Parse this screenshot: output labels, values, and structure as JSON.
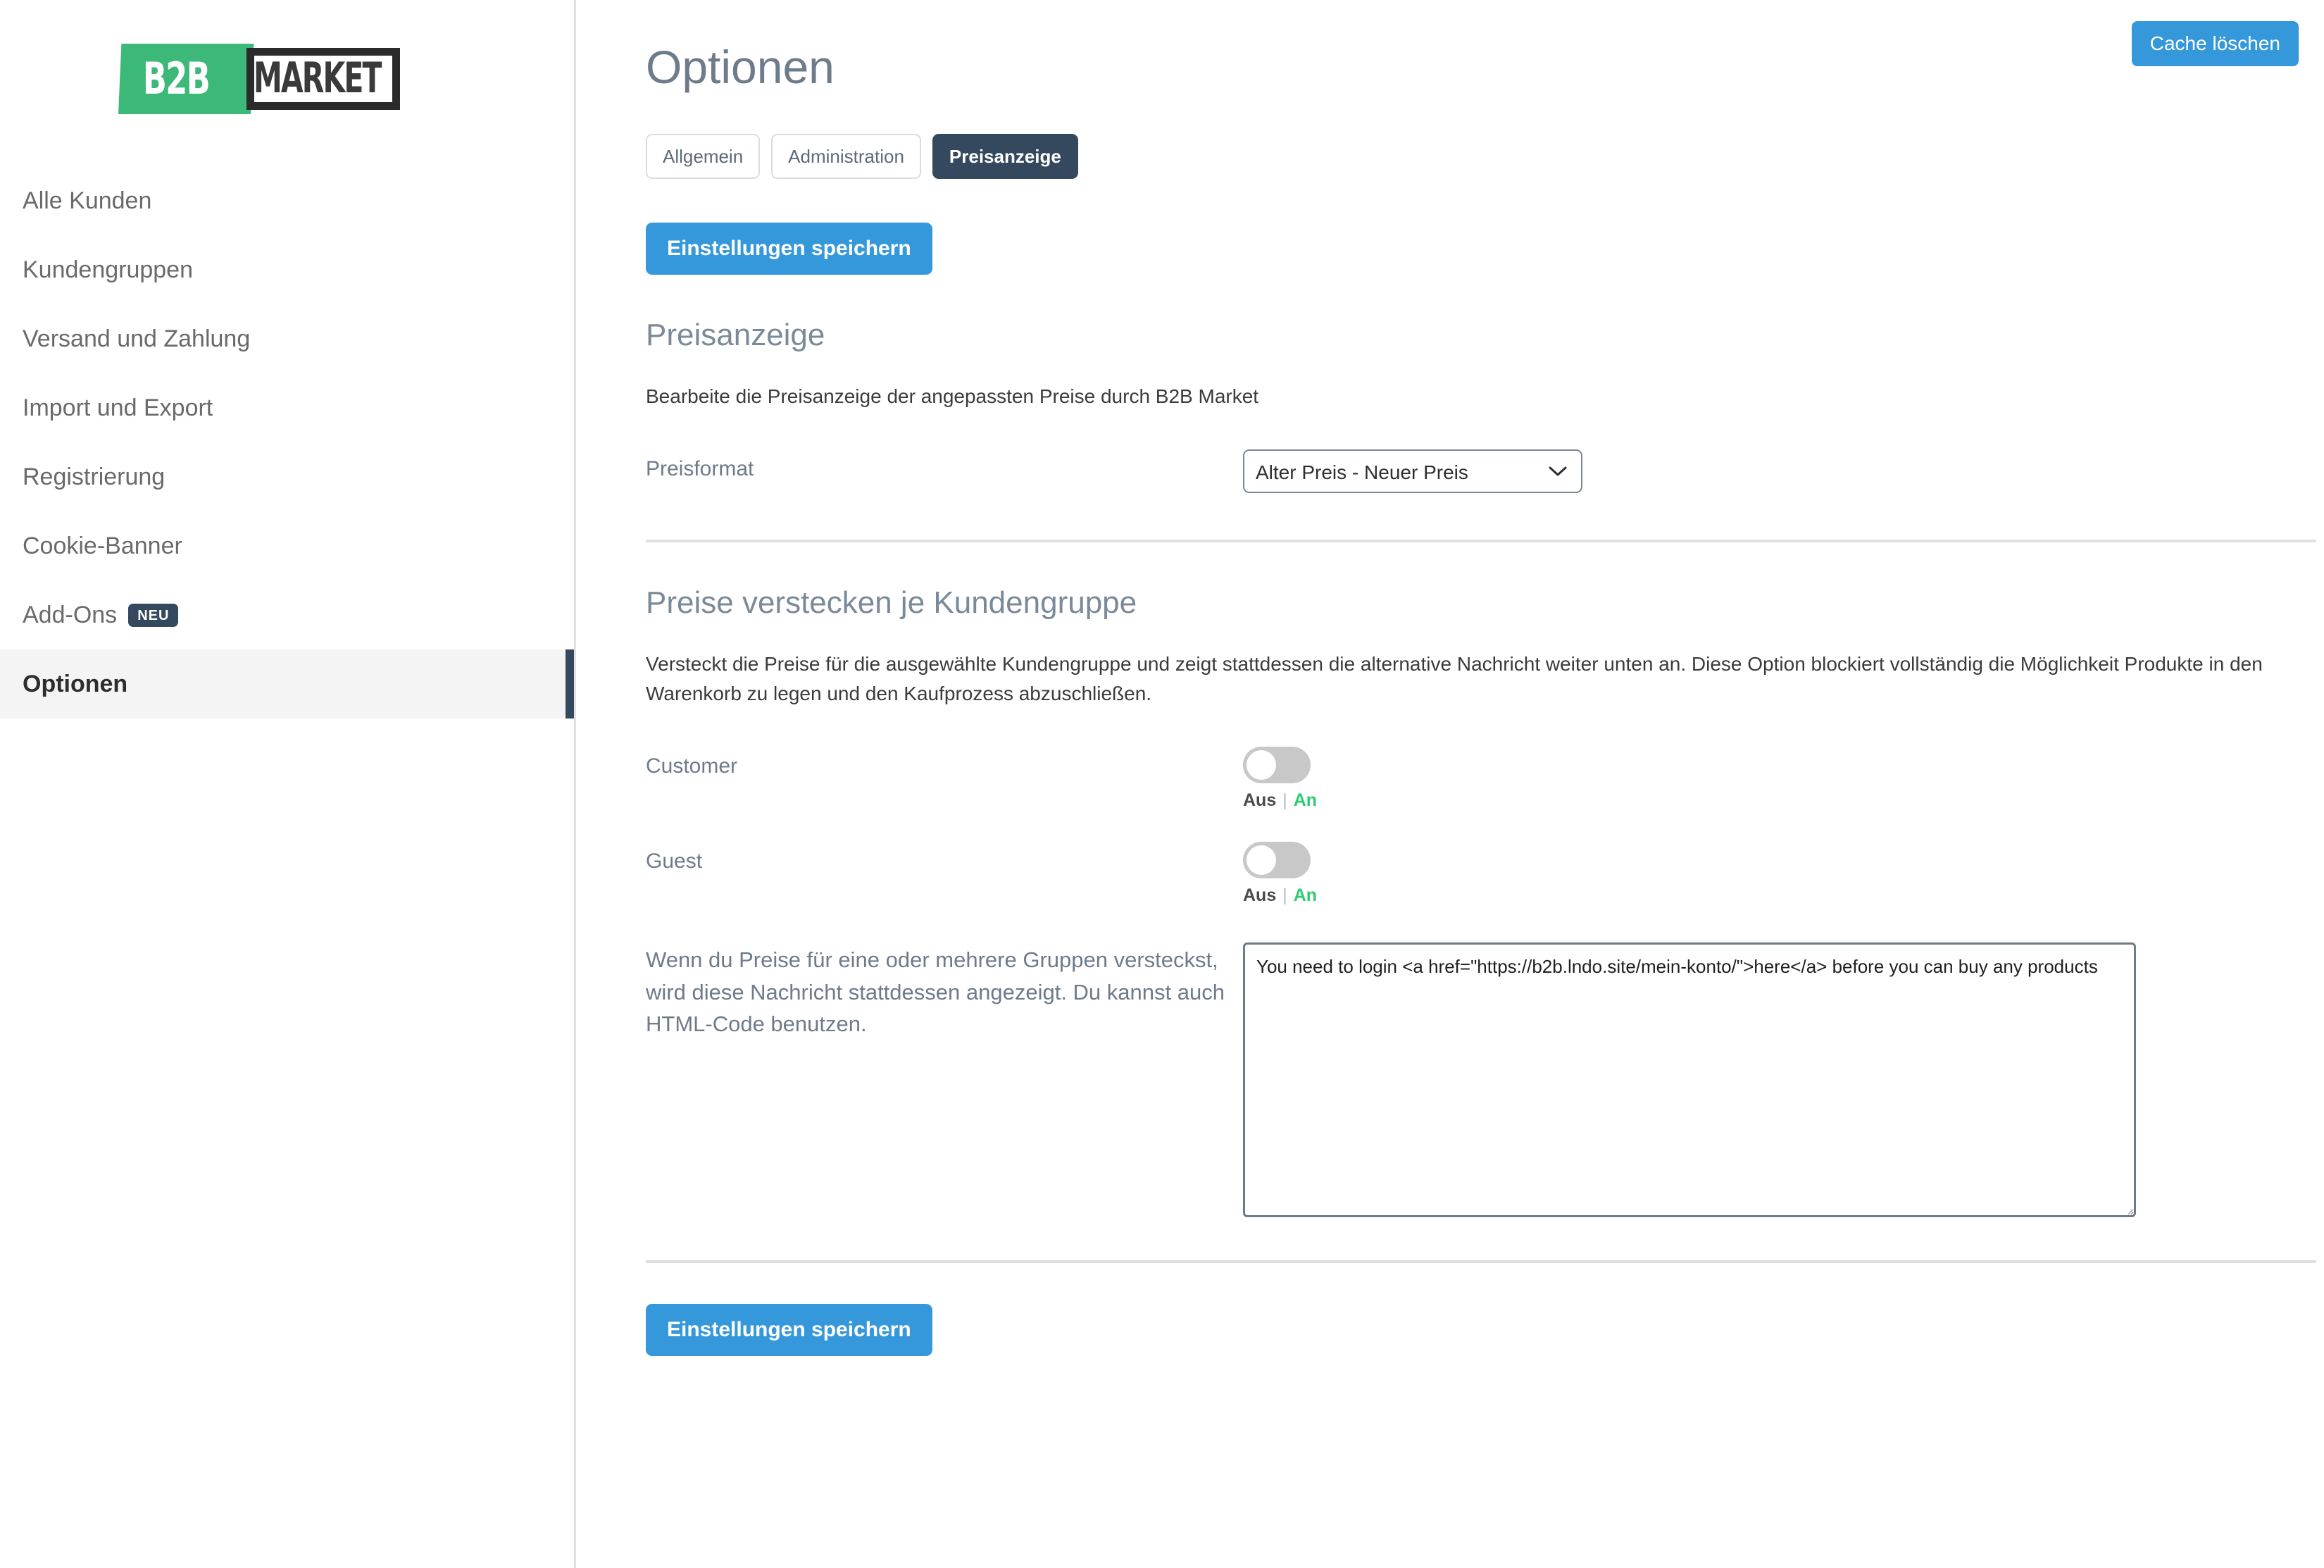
{
  "brand": {
    "logo_green_text": "B2B",
    "logo_box_text": "MARKET",
    "green_hex": "#3cb878",
    "dark_hex": "#2b2b2b"
  },
  "sidebar": {
    "items": [
      {
        "label": "Alle Kunden",
        "active": false
      },
      {
        "label": "Kundengruppen",
        "active": false
      },
      {
        "label": "Versand und Zahlung",
        "active": false
      },
      {
        "label": "Import und Export",
        "active": false
      },
      {
        "label": "Registrierung",
        "active": false
      },
      {
        "label": "Cookie-Banner",
        "active": false
      },
      {
        "label": "Add-Ons",
        "badge": "NEU",
        "active": false
      },
      {
        "label": "Optionen",
        "active": true
      }
    ]
  },
  "header": {
    "cache_button": "Cache löschen",
    "title": "Optionen"
  },
  "tabs": [
    {
      "label": "Allgemein",
      "active": false
    },
    {
      "label": "Administration",
      "active": false
    },
    {
      "label": "Preisanzeige",
      "active": true
    }
  ],
  "buttons": {
    "save_top": "Einstellungen speichern",
    "save_bottom": "Einstellungen speichern"
  },
  "sections": {
    "price_display": {
      "title": "Preisanzeige",
      "description": "Bearbeite die Preisanzeige der angepassten Preise durch B2B Market",
      "price_format_label": "Preisformat",
      "price_format_value": "Alter Preis - Neuer Preis",
      "price_format_options": [
        "Alter Preis - Neuer Preis"
      ]
    },
    "hide_prices": {
      "title": "Preise verstecken je Kundengruppe",
      "description": "Versteckt die Preise für die ausgewählte Kundengruppe und zeigt stattdessen die alternative Nachricht weiter unten an. Diese Option blockiert vollständig die Möglichkeit Produkte in den Warenkorb zu legen und den Kaufprozess abzuschließen.",
      "toggles": [
        {
          "label": "Customer",
          "state": "off",
          "off_label": "Aus",
          "separator": "|",
          "on_label": "An"
        },
        {
          "label": "Guest",
          "state": "off",
          "off_label": "Aus",
          "separator": "|",
          "on_label": "An"
        }
      ],
      "message_label": "Wenn du Preise für eine oder mehrere Gruppen versteckst, wird diese Nachricht stattdessen angezeigt. Du kannst auch HTML-Code benutzen.",
      "message_value": "You need to login <a href=\"https://b2b.lndo.site/mein-konto/\">here</a> before you can buy any products"
    }
  },
  "colors": {
    "accent_blue": "#3498db",
    "navy": "#34495e",
    "green": "#2ecc71",
    "heading_grey": "#6d7b8b"
  }
}
